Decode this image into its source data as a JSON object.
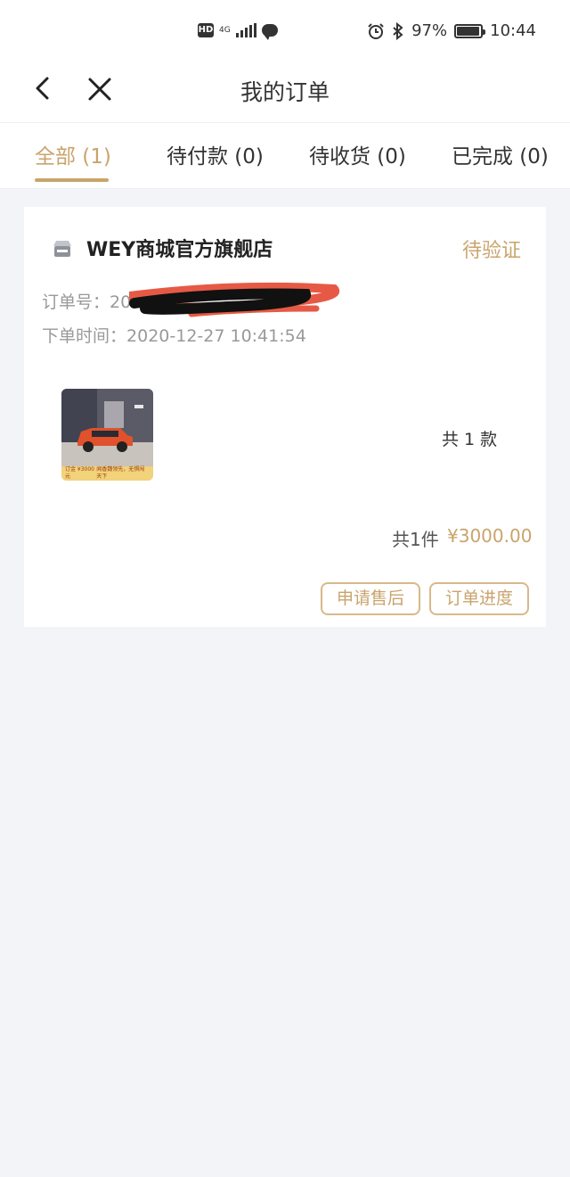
{
  "status_bar": {
    "left_badges": [
      "HD",
      "4G"
    ],
    "battery": "97%",
    "battery_level": 0.97,
    "time": "10:44"
  },
  "nav": {
    "title": "我的订单"
  },
  "tabs": [
    {
      "label": "全部 (1)",
      "active": true
    },
    {
      "label": "待付款 (0)",
      "active": false
    },
    {
      "label": "待收货 (0)",
      "active": false
    },
    {
      "label": "已完成 (0)",
      "active": false
    }
  ],
  "order": {
    "shop_name": "WEY商城官方旗舰店",
    "status": "待验证",
    "order_no_label": "订单号：",
    "order_no_visible": "20",
    "order_time_label": "下单时间：",
    "order_time": "2020-12-27 10:41:54",
    "item_count": "共 1 款",
    "total_qty": "共1件",
    "total_price": "¥3000.00",
    "thumb_label_left": "订金 ¥3000元",
    "thumb_label_right": "闻香魏领先，无惧闯天下"
  },
  "buttons": {
    "after_sales": "申请售后",
    "progress": "订单进度"
  },
  "colors": {
    "accent": "#c9a46c",
    "background": "#f3f4f8"
  }
}
